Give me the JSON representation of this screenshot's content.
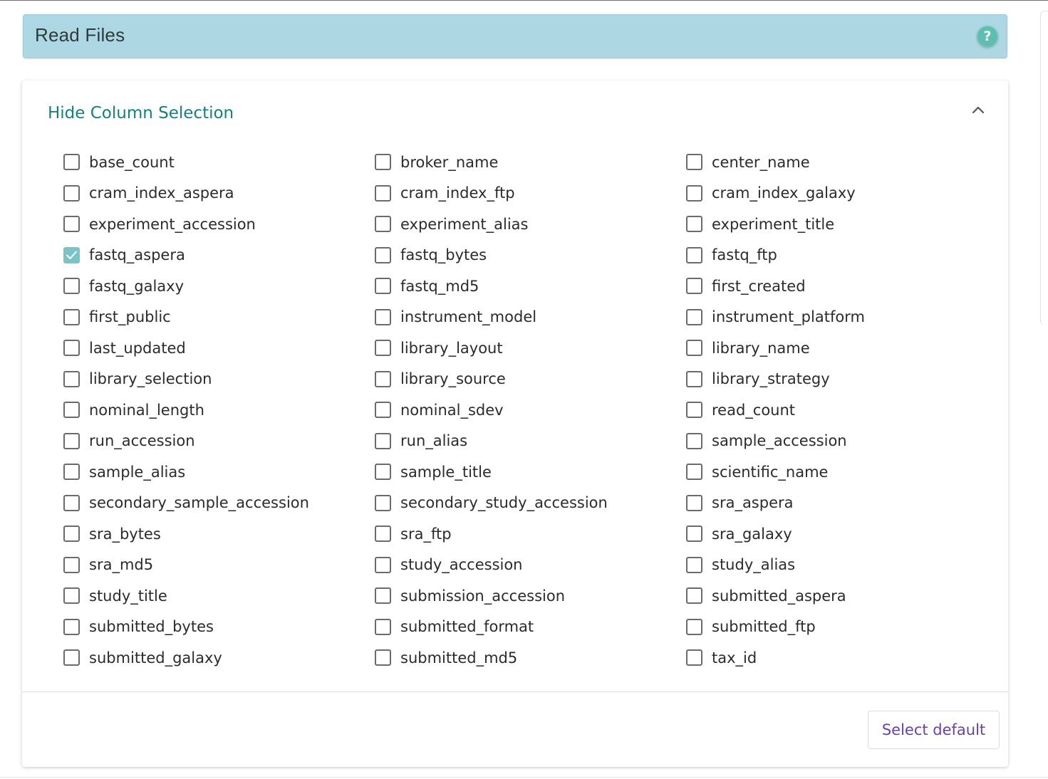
{
  "header": {
    "title": "Read Files",
    "help_glyph": "?",
    "help_icon": "question-circle-icon",
    "color": "#add8e3"
  },
  "column_selection": {
    "toggle_label": "Hide Column Selection",
    "toggle_icon": "chevron-up-icon",
    "accent_color": "#16807c",
    "checked_color": "#7bc4c6",
    "options": [
      {
        "label": "base_count",
        "checked": false
      },
      {
        "label": "broker_name",
        "checked": false
      },
      {
        "label": "center_name",
        "checked": false
      },
      {
        "label": "cram_index_aspera",
        "checked": false
      },
      {
        "label": "cram_index_ftp",
        "checked": false
      },
      {
        "label": "cram_index_galaxy",
        "checked": false
      },
      {
        "label": "experiment_accession",
        "checked": false
      },
      {
        "label": "experiment_alias",
        "checked": false
      },
      {
        "label": "experiment_title",
        "checked": false
      },
      {
        "label": "fastq_aspera",
        "checked": true
      },
      {
        "label": "fastq_bytes",
        "checked": false
      },
      {
        "label": "fastq_ftp",
        "checked": false
      },
      {
        "label": "fastq_galaxy",
        "checked": false
      },
      {
        "label": "fastq_md5",
        "checked": false
      },
      {
        "label": "first_created",
        "checked": false
      },
      {
        "label": "first_public",
        "checked": false
      },
      {
        "label": "instrument_model",
        "checked": false
      },
      {
        "label": "instrument_platform",
        "checked": false
      },
      {
        "label": "last_updated",
        "checked": false
      },
      {
        "label": "library_layout",
        "checked": false
      },
      {
        "label": "library_name",
        "checked": false
      },
      {
        "label": "library_selection",
        "checked": false
      },
      {
        "label": "library_source",
        "checked": false
      },
      {
        "label": "library_strategy",
        "checked": false
      },
      {
        "label": "nominal_length",
        "checked": false
      },
      {
        "label": "nominal_sdev",
        "checked": false
      },
      {
        "label": "read_count",
        "checked": false
      },
      {
        "label": "run_accession",
        "checked": false
      },
      {
        "label": "run_alias",
        "checked": false
      },
      {
        "label": "sample_accession",
        "checked": false
      },
      {
        "label": "sample_alias",
        "checked": false
      },
      {
        "label": "sample_title",
        "checked": false
      },
      {
        "label": "scientific_name",
        "checked": false
      },
      {
        "label": "secondary_sample_accession",
        "checked": false
      },
      {
        "label": "secondary_study_accession",
        "checked": false
      },
      {
        "label": "sra_aspera",
        "checked": false
      },
      {
        "label": "sra_bytes",
        "checked": false
      },
      {
        "label": "sra_ftp",
        "checked": false
      },
      {
        "label": "sra_galaxy",
        "checked": false
      },
      {
        "label": "sra_md5",
        "checked": false
      },
      {
        "label": "study_accession",
        "checked": false
      },
      {
        "label": "study_alias",
        "checked": false
      },
      {
        "label": "study_title",
        "checked": false
      },
      {
        "label": "submission_accession",
        "checked": false
      },
      {
        "label": "submitted_aspera",
        "checked": false
      },
      {
        "label": "submitted_bytes",
        "checked": false
      },
      {
        "label": "submitted_format",
        "checked": false
      },
      {
        "label": "submitted_ftp",
        "checked": false
      },
      {
        "label": "submitted_galaxy",
        "checked": false
      },
      {
        "label": "submitted_md5",
        "checked": false
      },
      {
        "label": "tax_id",
        "checked": false
      }
    ]
  },
  "footer": {
    "select_default_label": "Select default",
    "button_color": "#6a3fb0"
  }
}
